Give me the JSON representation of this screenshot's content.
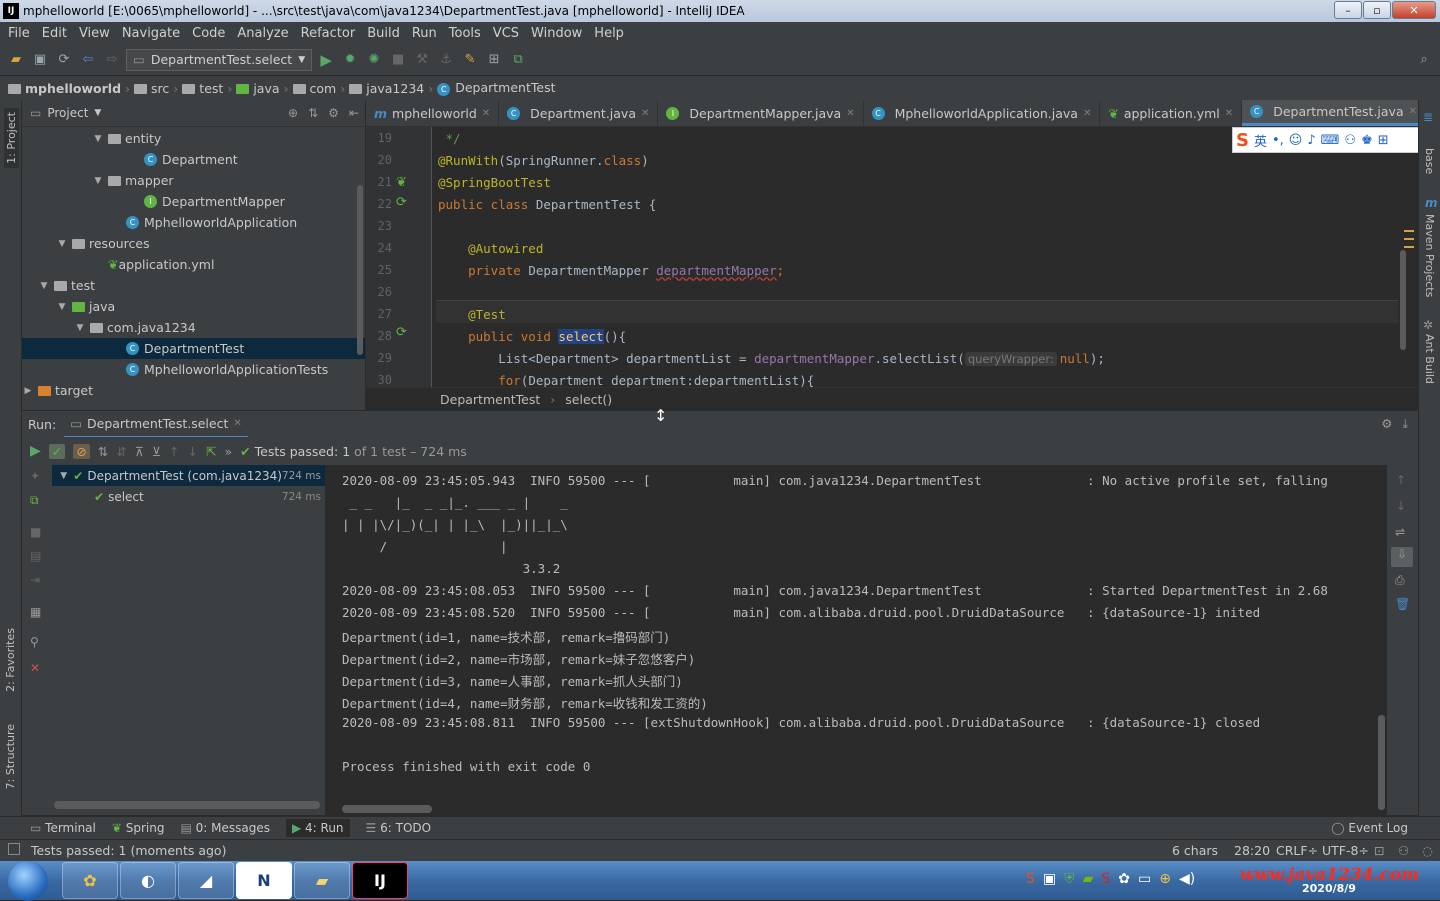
{
  "window": {
    "title": "mphelloworld [E:\\0065\\mphelloworld] - ...\\src\\test\\java\\com\\java1234\\DepartmentTest.java [mphelloworld] - IntelliJ IDEA"
  },
  "menu": [
    "File",
    "Edit",
    "View",
    "Navigate",
    "Code",
    "Analyze",
    "Refactor",
    "Build",
    "Run",
    "Tools",
    "VCS",
    "Window",
    "Help"
  ],
  "toolbar": {
    "run_config": "DepartmentTest.select"
  },
  "navbar": [
    "mphelloworld",
    "src",
    "test",
    "java",
    "com",
    "java1234",
    "DepartmentTest"
  ],
  "project_panel": {
    "title": "Project",
    "tree": [
      {
        "label": "entity",
        "indent": 5,
        "kind": "folder",
        "expanded": true
      },
      {
        "label": "Department",
        "indent": 7,
        "kind": "class"
      },
      {
        "label": "mapper",
        "indent": 5,
        "kind": "folder",
        "expanded": true
      },
      {
        "label": "DepartmentMapper",
        "indent": 7,
        "kind": "interface"
      },
      {
        "label": "MphelloworldApplication",
        "indent": 6,
        "kind": "class"
      },
      {
        "label": "resources",
        "indent": 3,
        "kind": "folder",
        "expanded": true
      },
      {
        "label": "application.yml",
        "indent": 5,
        "kind": "yml"
      },
      {
        "label": "test",
        "indent": 2,
        "kind": "folder",
        "expanded": true
      },
      {
        "label": "java",
        "indent": 3,
        "kind": "folder-green",
        "expanded": true
      },
      {
        "label": "com.java1234",
        "indent": 4,
        "kind": "folder",
        "expanded": true
      },
      {
        "label": "DepartmentTest",
        "indent": 6,
        "kind": "class",
        "selected": true
      },
      {
        "label": "MphelloworldApplicationTests",
        "indent": 6,
        "kind": "class"
      },
      {
        "label": "target",
        "indent": 1,
        "kind": "folder-orange",
        "expanded": false
      }
    ]
  },
  "editor": {
    "tabs": [
      {
        "label": "mphelloworld",
        "active": false
      },
      {
        "label": "Department.java",
        "active": false
      },
      {
        "label": "DepartmentMapper.java",
        "active": false
      },
      {
        "label": "MphelloworldApplication.java",
        "active": false
      },
      {
        "label": "application.yml",
        "active": false
      },
      {
        "label": "DepartmentTest.java",
        "active": true
      }
    ],
    "line_numbers": [
      "19",
      "20",
      "21",
      "22",
      "23",
      "24",
      "25",
      "26",
      "27",
      "28",
      "29",
      "30"
    ],
    "code": {
      "l19": " */",
      "l20a": "@RunWith",
      "l20b": "(SpringRunner.",
      "l20c": "class",
      "l20d": ")",
      "l21": "@SpringBootTest",
      "l22a": "public class ",
      "l22b": "DepartmentTest {",
      "l24": "    @Autowired",
      "l25a": "    private ",
      "l25b": "DepartmentMapper ",
      "l25c": "departmentMapper",
      "l25d": ";",
      "l27": "    @Test",
      "l28a": "    public void ",
      "l28b": "select",
      "l28c": "(){",
      "l29a": "        List<Department> departmentList = ",
      "l29b": "departmentMapper",
      "l29c": ".selectList(",
      "l29hint": "queryWrapper:",
      "l29d": "null",
      "l29e": ");",
      "l30a": "        for",
      "l30b": "(Department department:departmentList){"
    },
    "breadcrumb": [
      "DepartmentTest",
      "select()"
    ]
  },
  "ime": {
    "lang": "英"
  },
  "run_panel": {
    "label": "Run:",
    "tab": "DepartmentTest.select",
    "status_prefix": "Tests passed:",
    "status_count": "1",
    "status_suffix": "of 1 test – 724 ms",
    "tree": [
      {
        "label": "DepartmentTest (com.java1234)",
        "time": "724 ms"
      },
      {
        "label": "select",
        "time": "724 ms"
      }
    ]
  },
  "console": [
    "2020-08-09 23:45:05.943  INFO 59500 --- [           main] com.java1234.DepartmentTest              : No active profile set, falling",
    " _ _   |_  _ _|_. ___ _ |    _",
    "| | |\\/|_)(_| | |_\\  |_)||_|_\\",
    "     /               |",
    "                        3.3.2",
    "2020-08-09 23:45:08.053  INFO 59500 --- [           main] com.java1234.DepartmentTest              : Started DepartmentTest in 2.68",
    "2020-08-09 23:45:08.520  INFO 59500 --- [           main] com.alibaba.druid.pool.DruidDataSource   : {dataSource-1} inited",
    "Department(id=1, name=技术部, remark=撸码部门)",
    "Department(id=2, name=市场部, remark=妹子忽悠客户)",
    "Department(id=3, name=人事部, remark=抓人头部门)",
    "Department(id=4, name=财务部, remark=收钱和发工资的)",
    "2020-08-09 23:45:08.811  INFO 59500 --- [extShutdownHook] com.alibaba.druid.pool.DruidDataSource   : {dataSource-1} closed",
    "",
    "Process finished with exit code 0"
  ],
  "side_tabs": {
    "left": [
      "1: Project",
      "2: Favorites",
      "7: Structure"
    ],
    "right": [
      "base",
      "Maven Projects",
      "Ant Build"
    ]
  },
  "bottom_tabs": [
    "Terminal",
    "Spring",
    "0: Messages",
    "4: Run",
    "6: TODO"
  ],
  "event_log": "Event Log",
  "statusbar": {
    "message": "Tests passed: 1 (moments ago)",
    "chars": "6 chars",
    "position": "28:20",
    "line_sep": "CRLF÷",
    "encoding": "UTF-8÷"
  },
  "taskbar": {
    "watermark": "www.java1234.com",
    "date": "2020/8/9"
  },
  "colors": {
    "accent": "#4a88c7",
    "pass": "#62b543",
    "ide_bg": "#2b2b2b",
    "panel_bg": "#3c3f41"
  }
}
